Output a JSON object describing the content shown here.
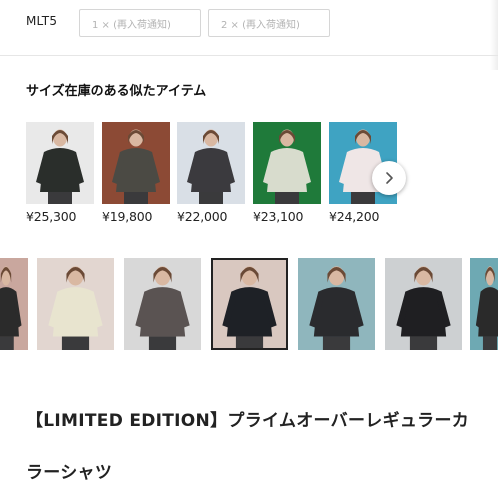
{
  "size_selector": {
    "code": "MLT5",
    "options": [
      {
        "label": "1 × (再入荷通知)"
      },
      {
        "label": "2 × (再入荷通知)"
      }
    ]
  },
  "similar": {
    "title": "サイズ在庫のある似たアイテム",
    "items": [
      {
        "price": "¥25,300",
        "bg": "#e9e9e9",
        "garment": "#2a2e2b",
        "icon": "product-photo-black-shirt"
      },
      {
        "price": "¥19,800",
        "bg": "#8c4a35",
        "garment": "#4b4a44",
        "icon": "product-photo-grey-shirt"
      },
      {
        "price": "¥22,000",
        "bg": "#d9dfe6",
        "garment": "#3b3a3e",
        "icon": "product-photo-pattern-shirt"
      },
      {
        "price": "¥23,100",
        "bg": "#1f7a3a",
        "garment": "#d8dccd",
        "icon": "product-photo-floral-shirt"
      },
      {
        "price": "¥24,200",
        "bg": "#3fa3c2",
        "garment": "#efe6e6",
        "icon": "product-photo-pink-shirt"
      }
    ],
    "next_icon": "chevron-right-icon"
  },
  "gallery": {
    "thumbs": [
      {
        "bg": "#c9a79e",
        "garment": "#2b2b2b"
      },
      {
        "bg": "#e2d6d0",
        "garment": "#e8e4cf"
      },
      {
        "bg": "#d8d8d8",
        "garment": "#5a5352"
      },
      {
        "bg": "#d9c8c0",
        "garment": "#1e2126",
        "selected": true
      },
      {
        "bg": "#8fb6bd",
        "garment": "#2a2b2e"
      },
      {
        "bg": "#cdd0d2",
        "garment": "#1f1f22"
      },
      {
        "bg": "#6ea9b3",
        "garment": "#2a2a2a"
      }
    ]
  },
  "product": {
    "title": "【LIMITED EDITION】プライムオーバーレギュラーカラーシャツ"
  }
}
